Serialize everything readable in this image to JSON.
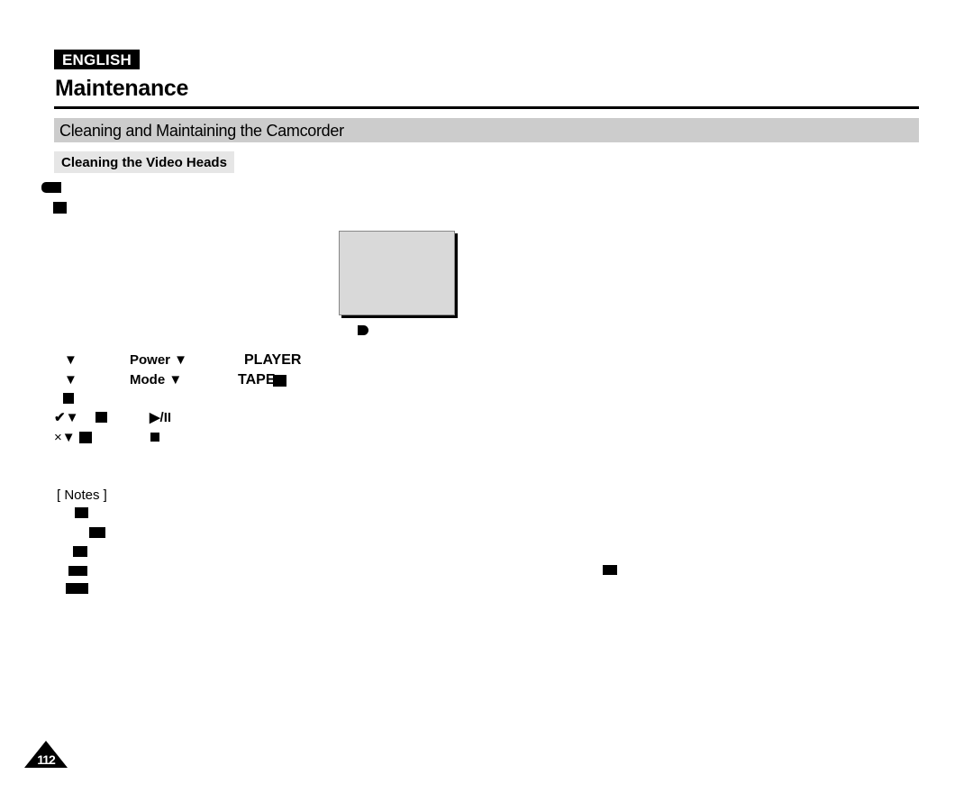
{
  "header": {
    "language_badge": "ENGLISH",
    "chapter_title": "Maintenance"
  },
  "section": {
    "title": "Cleaning and Maintaining the Camcorder",
    "subsection_title": "Cleaning the Video Heads"
  },
  "figure": {
    "marker_icon": "d-shaped-marker"
  },
  "steps": {
    "row1": {
      "marker": "▼",
      "label": "Power ▼",
      "value": "PLAYER"
    },
    "row2": {
      "marker": "▼",
      "label": "Mode ▼",
      "value": "TAPE"
    },
    "row4": {
      "marker": "✔▼",
      "button_icon": "▶/II"
    },
    "row5": {
      "marker": "×▼",
      "button_icon": "■"
    }
  },
  "notes": {
    "heading": "[ Notes ]"
  },
  "footer": {
    "page_number": "112"
  }
}
